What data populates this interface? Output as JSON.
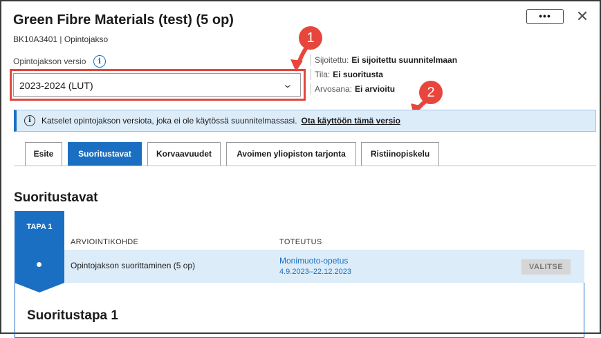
{
  "header": {
    "title": "Green Fibre Materials (test) (5 op)",
    "subtitle": "BK10A3401 | Opintojakso",
    "more_label": "•••",
    "close_label": "✕"
  },
  "version": {
    "label": "Opintojakson versio",
    "info_icon": "i",
    "selected": "2023-2024 (LUT)"
  },
  "meta": [
    {
      "key": "Sijoitettu:",
      "value": "Ei sijoitettu suunnitelmaan"
    },
    {
      "key": "Tila:",
      "value": "Ei suoritusta"
    },
    {
      "key": "Arvosana:",
      "value": "Ei arvioitu"
    }
  ],
  "callouts": [
    "1",
    "2"
  ],
  "banner": {
    "text": "Katselet opintojakson versiota, joka ei ole käytössä suunnitelmassasi.",
    "link": "Ota käyttöön tämä versio"
  },
  "tabs": [
    "Esite",
    "Suoritustavat",
    "Korvaavuudet",
    "Avoimen yliopiston tarjonta",
    "Ristiinopiskelu"
  ],
  "active_tab": "Suoritustavat",
  "section": {
    "heading": "Suoritustavat",
    "tapa_label": "TAPA 1",
    "columns": [
      "ARVIOINTIKOHDE",
      "TOTEUTUS"
    ],
    "row": {
      "item": "Opintojakson suorittaminen (5 op)",
      "implementation": "Monimuoto-opetus",
      "dates": "4.9.2023–22.12.2023",
      "button": "VALITSE"
    },
    "detail_title": "Suoritustapa 1"
  },
  "colors": {
    "accent": "#1a6fc2",
    "callout": "#e8463c",
    "banner_bg": "#dcecf9"
  }
}
